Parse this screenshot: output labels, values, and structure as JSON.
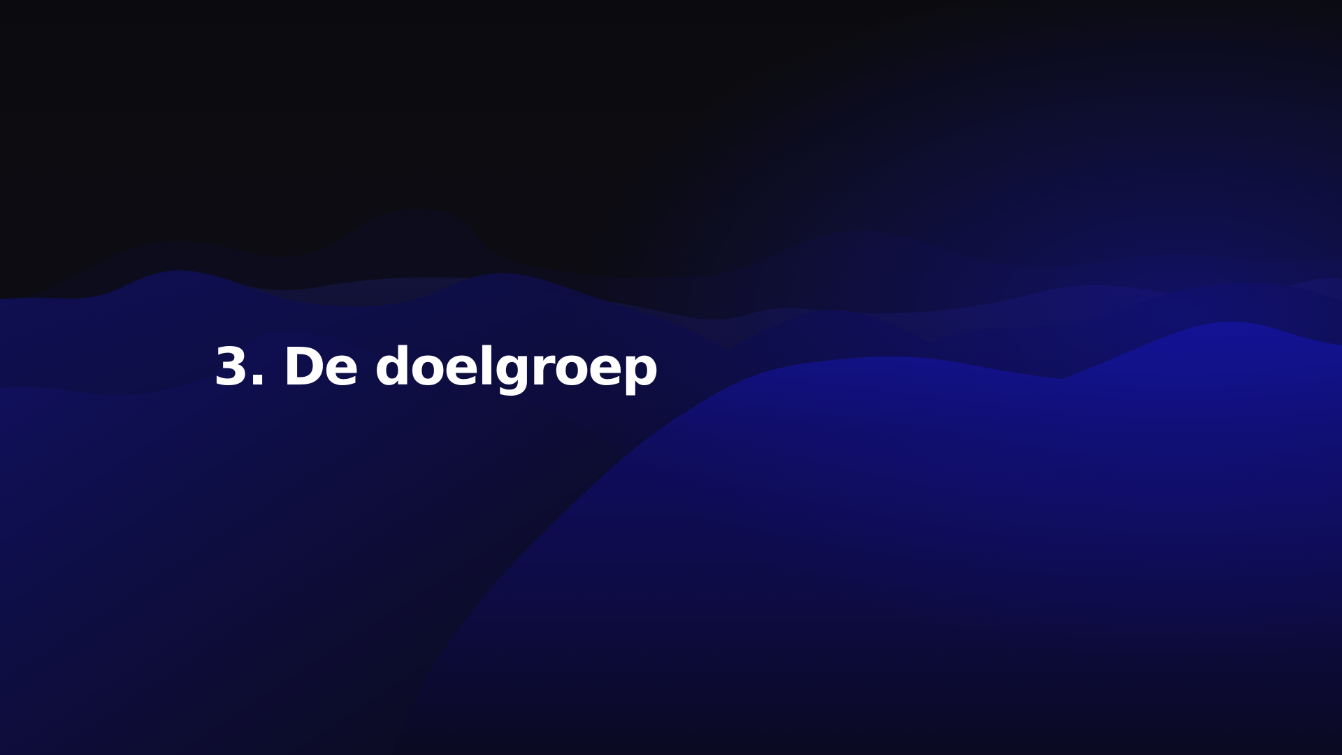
{
  "slide": {
    "title": "3. De doelgroep"
  },
  "theme": {
    "background": "#0b0b10",
    "accent_blue": "#10108a",
    "deep_blue": "#0c0c45",
    "title_color": "#ffffff"
  }
}
